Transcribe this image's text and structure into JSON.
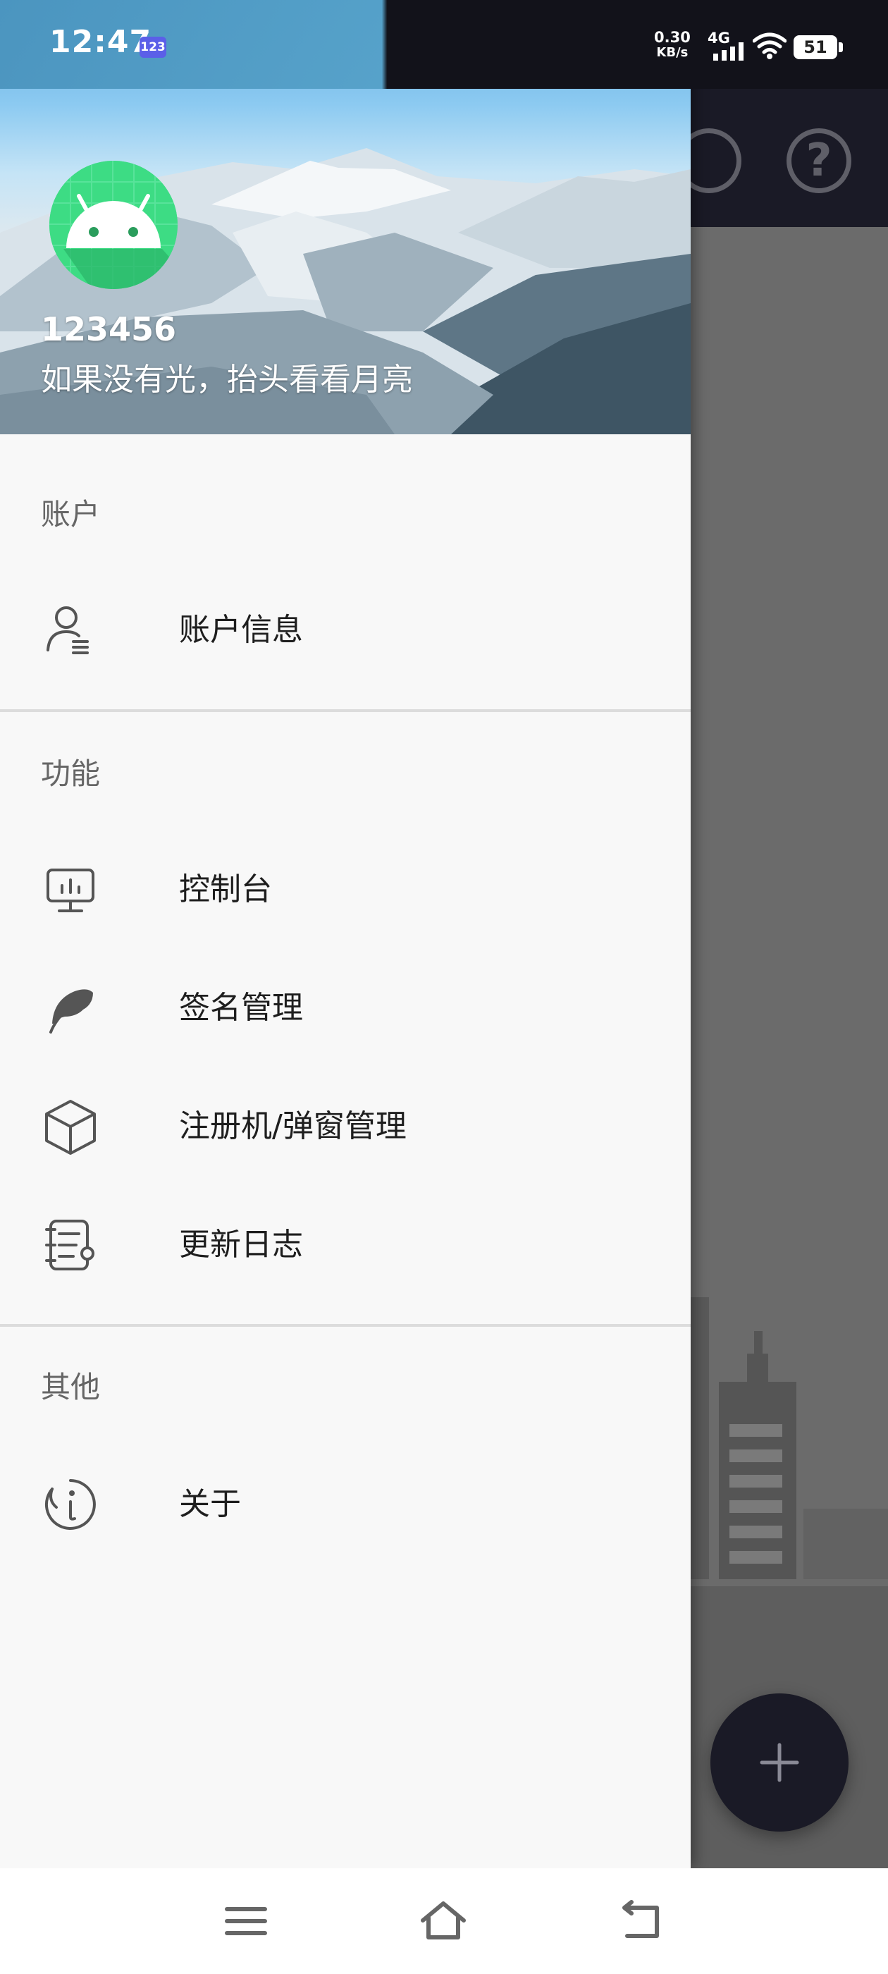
{
  "status_bar": {
    "time": "12:47",
    "app_badge": "123",
    "net_speed_value": "0.30",
    "net_speed_unit": "KB/s",
    "network_type": "4G",
    "battery": "51",
    "icons": [
      "signal-icon",
      "wifi-icon",
      "battery-icon"
    ]
  },
  "header": {
    "username": "123456",
    "motto": "如果没有光，抬头看看月亮",
    "avatar_icon": "android-icon"
  },
  "sections": [
    {
      "title": "账户",
      "items": [
        {
          "label": "账户信息",
          "icon": "account-info-icon"
        }
      ]
    },
    {
      "title": "功能",
      "items": [
        {
          "label": "控制台",
          "icon": "dashboard-icon"
        },
        {
          "label": "签名管理",
          "icon": "feather-icon"
        },
        {
          "label": "注册机/弹窗管理",
          "icon": "cube-icon"
        },
        {
          "label": "更新日志",
          "icon": "log-icon"
        }
      ]
    },
    {
      "title": "其他",
      "items": [
        {
          "label": "关于",
          "icon": "about-icon"
        }
      ]
    }
  ],
  "background_app": {
    "help_symbol": "?",
    "fab_symbol": "+"
  },
  "colors": {
    "toolbar": "#1a1a26",
    "drawer_bg": "#f8f8f8",
    "android_green": "#3ddc84",
    "scrim": "#6b6b6b"
  }
}
